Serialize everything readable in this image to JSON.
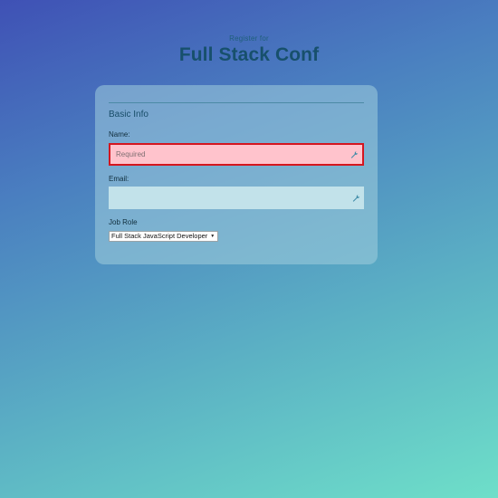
{
  "header": {
    "subtitle": "Register for",
    "title": "Full Stack Conf"
  },
  "form": {
    "section_title": "Basic Info",
    "name": {
      "label": "Name:",
      "placeholder": "Required",
      "value": "",
      "state": "invalid"
    },
    "email": {
      "label": "Email:",
      "placeholder": "",
      "value": ""
    },
    "job_role": {
      "label": "Job Role",
      "selected": "Full Stack JavaScript Developer"
    }
  },
  "icons": {
    "field_icon": "wrench-icon"
  },
  "colors": {
    "gradient_start": "#3f51b5",
    "gradient_end": "#6edfc9",
    "title": "#17506c",
    "invalid_border": "#d4161f",
    "invalid_fill": "#ffc3cc"
  }
}
